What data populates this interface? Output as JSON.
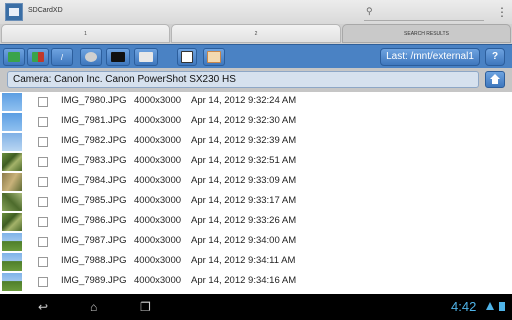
{
  "app": {
    "title": "SDCardXD",
    "icon": "app-sdcard-icon"
  },
  "search": {
    "icon": "search-icon",
    "value": ""
  },
  "overflow_icon": "⋮",
  "tabs": [
    {
      "label": "1",
      "active": false
    },
    {
      "label": "2",
      "active": false
    },
    {
      "label": "SEARCH RESULTS",
      "active": true
    }
  ],
  "toolbar": {
    "buttons": [
      {
        "name": "import-button",
        "icon": "import-arrow-icon",
        "color": "#3aa34a"
      },
      {
        "name": "camera-card-button",
        "icon": "camera-card-icon",
        "color": "#c0392b"
      },
      {
        "name": "root-button",
        "icon": "slash-icon",
        "glyph": "/"
      },
      {
        "name": "network-button",
        "icon": "network-drive-icon",
        "color": "#d0d0d0"
      },
      {
        "name": "sd-card-button",
        "icon": "sd-card-icon",
        "color": "#111111"
      },
      {
        "name": "storage-button",
        "icon": "storage-icon",
        "color": "#e8e8e8"
      },
      {
        "name": "select-all-button",
        "icon": "checkbox-icon",
        "color": "#ffffff"
      },
      {
        "name": "copy-button",
        "icon": "copy-pages-icon",
        "color": "#f3d9b0"
      }
    ],
    "last_label": "Last: /mnt/external1",
    "help_label": "?"
  },
  "camera": {
    "label": "Camera: Canon Inc. Canon PowerShot SX230 HS",
    "home_icon": "home-icon"
  },
  "files": [
    {
      "thumb": "sky",
      "name": "IMG_7980.JPG",
      "size": "4000x3000",
      "date": "Apr 14, 2012 9:32:24 AM"
    },
    {
      "thumb": "sky",
      "name": "IMG_7981.JPG",
      "size": "4000x3000",
      "date": "Apr 14, 2012 9:32:30 AM"
    },
    {
      "thumb": "sky-hazy",
      "name": "IMG_7982.JPG",
      "size": "4000x3000",
      "date": "Apr 14, 2012 9:32:39 AM"
    },
    {
      "thumb": "plant",
      "name": "IMG_7983.JPG",
      "size": "4000x3000",
      "date": "Apr 14, 2012 9:32:51 AM"
    },
    {
      "thumb": "dry",
      "name": "IMG_7984.JPG",
      "size": "4000x3000",
      "date": "Apr 14, 2012 9:33:09 AM"
    },
    {
      "thumb": "plant2",
      "name": "IMG_7985.JPG",
      "size": "4000x3000",
      "date": "Apr 14, 2012 9:33:17 AM"
    },
    {
      "thumb": "plant",
      "name": "IMG_7986.JPG",
      "size": "4000x3000",
      "date": "Apr 14, 2012 9:33:26 AM"
    },
    {
      "thumb": "tree",
      "name": "IMG_7987.JPG",
      "size": "4000x3000",
      "date": "Apr 14, 2012 9:34:00 AM"
    },
    {
      "thumb": "tree",
      "name": "IMG_7988.JPG",
      "size": "4000x3000",
      "date": "Apr 14, 2012 9:34:11 AM"
    },
    {
      "thumb": "tree",
      "name": "IMG_7989.JPG",
      "size": "4000x3000",
      "date": "Apr 14, 2012 9:34:16 AM"
    }
  ],
  "navbar": {
    "back_icon": "back-arrow-icon",
    "home_icon": "home-nav-icon",
    "recents_icon": "recent-apps-icon",
    "clock": "4:42",
    "accent": "#4fb3e8"
  }
}
